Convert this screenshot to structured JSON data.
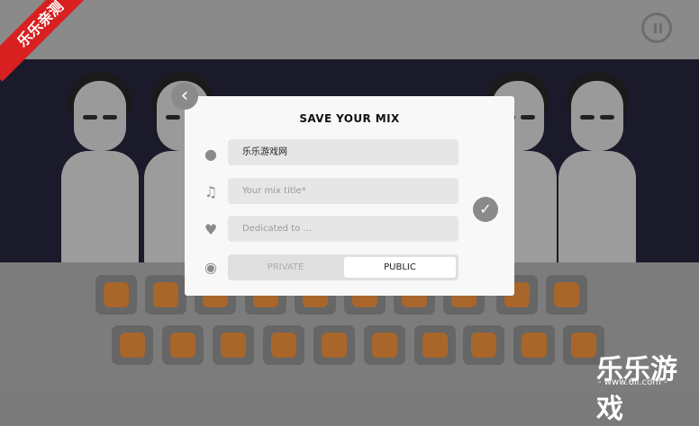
{
  "modal": {
    "title": "SAVE YOUR MIX",
    "name_value": "乐乐游戏网",
    "mix_title_placeholder": "Your mix title*",
    "dedicated_placeholder": "Dedicated to ...",
    "private_label": "PRIVATE",
    "public_label": "PUBLIC"
  },
  "icons": {
    "back": "chevron-left-icon",
    "user": "user-icon",
    "music": "music-note-icon",
    "heart": "heart-icon",
    "eye": "eye-icon",
    "check": "check-icon",
    "pause": "pause-icon"
  },
  "watermark": {
    "corner": "乐乐亲测",
    "brand": "乐乐游戏",
    "url": "- www.6ll.com -"
  },
  "colors": {
    "accent": "#a8662a",
    "ribbon": "#d82020"
  }
}
